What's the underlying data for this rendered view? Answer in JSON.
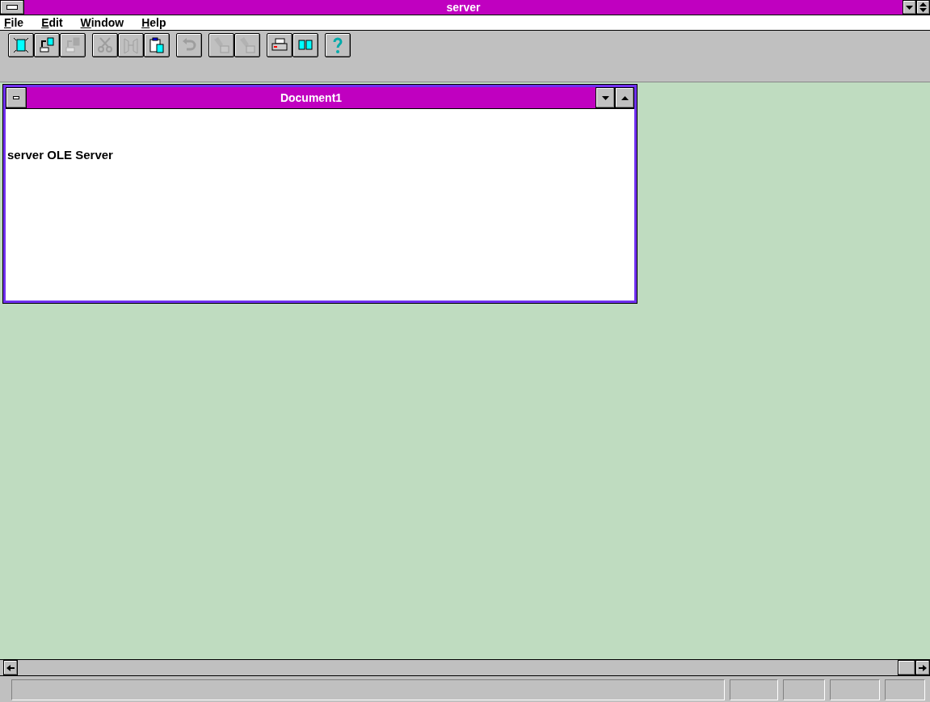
{
  "window": {
    "title": "server"
  },
  "menu": [
    {
      "label": "File"
    },
    {
      "label": "Edit"
    },
    {
      "label": "Window"
    },
    {
      "label": "Help"
    }
  ],
  "toolbar": [
    {
      "kind": "new",
      "disabled": false
    },
    {
      "kind": "open",
      "disabled": false
    },
    {
      "kind": "save",
      "disabled": true
    },
    {
      "kind": "gap"
    },
    {
      "kind": "cut",
      "disabled": true
    },
    {
      "kind": "copy",
      "disabled": true
    },
    {
      "kind": "paste",
      "disabled": false
    },
    {
      "kind": "gap"
    },
    {
      "kind": "undo",
      "disabled": true
    },
    {
      "kind": "gap"
    },
    {
      "kind": "find",
      "disabled": true
    },
    {
      "kind": "replace",
      "disabled": true
    },
    {
      "kind": "gap"
    },
    {
      "kind": "print",
      "disabled": false
    },
    {
      "kind": "preview",
      "disabled": false
    },
    {
      "kind": "gap"
    },
    {
      "kind": "help",
      "disabled": false
    }
  ],
  "document": {
    "title": "Document1",
    "text": "server OLE Server"
  }
}
